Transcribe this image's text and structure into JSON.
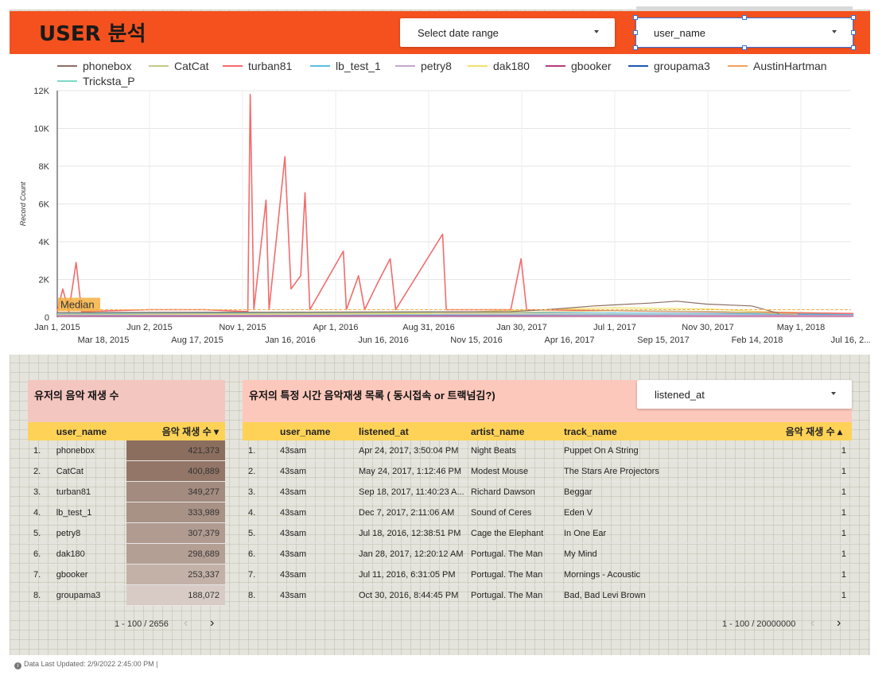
{
  "header": {
    "title": "USER 분석",
    "date_range_label": "Select date range",
    "user_filter_label": "user_name"
  },
  "legend": [
    "phonebox",
    "CatCat",
    "turban81",
    "lb_test_1",
    "petry8",
    "dak180",
    "gbooker",
    "groupama3",
    "AustinHartman",
    "Tricksta_P"
  ],
  "chart_data": {
    "type": "line",
    "ylabel": "Record Count",
    "ylim": [
      0,
      12000
    ],
    "y_ticks": [
      "0",
      "2K",
      "4K",
      "6K",
      "8K",
      "10K",
      "12K"
    ],
    "x_ticks_top": [
      "Jan 1, 2015",
      "Jun 2, 2015",
      "Nov 1, 2015",
      "Apr 1, 2016",
      "Aug 31, 2016",
      "Jan 30, 2017",
      "Jul 1, 2017",
      "Nov 30, 2017",
      "May 1, 2018"
    ],
    "x_ticks_bottom": [
      "Mar 18, 2015",
      "Aug 17, 2015",
      "Jan 16, 2016",
      "Jun 16, 2016",
      "Nov 15, 2016",
      "Apr 16, 2017",
      "Sep 15, 2017",
      "Feb 14, 2018",
      "Jul 16, 2..."
    ],
    "reference_line": {
      "label": "Median",
      "value": 400
    },
    "series": [
      {
        "name": "phonebox",
        "color": "#8d6e63",
        "points": [
          [
            "2015-01-01",
            250
          ],
          [
            "2016-06-01",
            280
          ],
          [
            "2017-01-15",
            300
          ],
          [
            "2017-03-15",
            400
          ],
          [
            "2017-06-01",
            600
          ],
          [
            "2017-09-01",
            750
          ],
          [
            "2017-10-15",
            850
          ],
          [
            "2017-12-01",
            700
          ],
          [
            "2018-02-15",
            600
          ],
          [
            "2018-04-01",
            200
          ]
        ]
      },
      {
        "name": "CatCat",
        "color": "#c5ca85",
        "points": [
          [
            "2015-01-01",
            150
          ],
          [
            "2016-01-01",
            200
          ],
          [
            "2017-01-01",
            250
          ],
          [
            "2017-08-01",
            350
          ],
          [
            "2018-01-01",
            300
          ],
          [
            "2018-05-01",
            150
          ]
        ]
      },
      {
        "name": "turban81",
        "color": "#f26b6b",
        "points": [
          [
            "2015-01-01",
            300
          ],
          [
            "2015-01-10",
            1500
          ],
          [
            "2015-01-20",
            300
          ],
          [
            "2015-02-01",
            2900
          ],
          [
            "2015-02-10",
            300
          ],
          [
            "2015-06-01",
            400
          ],
          [
            "2015-09-01",
            400
          ],
          [
            "2015-11-10",
            300
          ],
          [
            "2015-11-14",
            11800
          ],
          [
            "2015-11-20",
            400
          ],
          [
            "2015-12-10",
            6200
          ],
          [
            "2015-12-15",
            400
          ],
          [
            "2016-01-10",
            8500
          ],
          [
            "2016-01-20",
            1500
          ],
          [
            "2016-02-05",
            2200
          ],
          [
            "2016-02-12",
            6600
          ],
          [
            "2016-02-20",
            400
          ],
          [
            "2016-04-15",
            3500
          ],
          [
            "2016-04-20",
            400
          ],
          [
            "2016-05-10",
            2200
          ],
          [
            "2016-05-20",
            400
          ],
          [
            "2016-06-10",
            1800
          ],
          [
            "2016-07-01",
            3100
          ],
          [
            "2016-07-10",
            400
          ],
          [
            "2016-09-25",
            4400
          ],
          [
            "2016-10-01",
            400
          ],
          [
            "2017-01-15",
            400
          ],
          [
            "2017-02-01",
            3100
          ],
          [
            "2017-02-10",
            400
          ],
          [
            "2018-08-01",
            200
          ]
        ]
      },
      {
        "name": "lb_test_1",
        "color": "#5bc0de",
        "points": [
          [
            "2015-01-01",
            200
          ],
          [
            "2016-01-01",
            250
          ],
          [
            "2017-01-01",
            250
          ],
          [
            "2018-01-01",
            200
          ],
          [
            "2018-08-01",
            150
          ]
        ]
      },
      {
        "name": "petry8",
        "color": "#c3a8cf",
        "points": [
          [
            "2015-01-01",
            100
          ],
          [
            "2017-01-01",
            120
          ],
          [
            "2018-08-01",
            100
          ]
        ]
      },
      {
        "name": "dak180",
        "color": "#f1e06b",
        "points": [
          [
            "2015-01-01",
            100
          ],
          [
            "2016-09-01",
            200
          ],
          [
            "2017-01-01",
            350
          ],
          [
            "2017-07-01",
            500
          ],
          [
            "2017-12-01",
            450
          ],
          [
            "2018-03-01",
            300
          ],
          [
            "2018-08-01",
            200
          ]
        ]
      },
      {
        "name": "gbooker",
        "color": "#b73a7a",
        "points": [
          [
            "2015-01-01",
            50
          ],
          [
            "2018-08-01",
            50
          ]
        ]
      },
      {
        "name": "groupama3",
        "color": "#1e56b0",
        "points": [
          [
            "2015-01-01",
            80
          ],
          [
            "2017-01-01",
            100
          ],
          [
            "2018-08-01",
            120
          ]
        ]
      },
      {
        "name": "AustinHartman",
        "color": "#f5a05a",
        "points": [
          [
            "2015-01-01",
            180
          ],
          [
            "2017-01-01",
            220
          ],
          [
            "2018-08-01",
            200
          ]
        ]
      },
      {
        "name": "Tricksta_P",
        "color": "#7fd9c9",
        "points": [
          [
            "2015-01-01",
            120
          ],
          [
            "2017-01-01",
            150
          ],
          [
            "2018-08-01",
            120
          ]
        ]
      }
    ]
  },
  "left_table": {
    "title": "유저의 음악 재생 수",
    "headers": [
      "user_name",
      "음악 재생 수 ▾"
    ],
    "max_value": 421373,
    "rows": [
      {
        "num": "1.",
        "user": "phonebox",
        "count": "421,373",
        "value": 421373
      },
      {
        "num": "2.",
        "user": "CatCat",
        "count": "400,889",
        "value": 400889
      },
      {
        "num": "3.",
        "user": "turban81",
        "count": "349,277",
        "value": 349277
      },
      {
        "num": "4.",
        "user": "lb_test_1",
        "count": "333,989",
        "value": 333989
      },
      {
        "num": "5.",
        "user": "petry8",
        "count": "307,379",
        "value": 307379
      },
      {
        "num": "6.",
        "user": "dak180",
        "count": "298,689",
        "value": 298689
      },
      {
        "num": "7.",
        "user": "gbooker",
        "count": "253,337",
        "value": 253337
      },
      {
        "num": "8.",
        "user": "groupama3",
        "count": "188,072",
        "value": 188072
      }
    ],
    "pager": "1 - 100 / 2656"
  },
  "right_table": {
    "title": "유저의 특정 시간 음악재생 목록 ( 동시접속 or 트랙넘김?)",
    "filter_label": "listened_at",
    "headers": [
      "user_name",
      "listened_at",
      "artist_name",
      "track_name",
      "음악 재생 수 ▴"
    ],
    "rows": [
      {
        "num": "1.",
        "user": "43sam",
        "listened": "Apr 24, 2017, 3:50:04 PM",
        "artist": "Night Beats",
        "track": "Puppet On A String",
        "count": "1"
      },
      {
        "num": "2.",
        "user": "43sam",
        "listened": "May 24, 2017, 1:12:46 PM",
        "artist": "Modest Mouse",
        "track": "The Stars Are Projectors",
        "count": "1"
      },
      {
        "num": "3.",
        "user": "43sam",
        "listened": "Sep 18, 2017, 11:40:23 A...",
        "artist": "Richard Dawson",
        "track": "Beggar",
        "count": "1"
      },
      {
        "num": "4.",
        "user": "43sam",
        "listened": "Dec 7, 2017, 2:11:06 AM",
        "artist": "Sound of Ceres",
        "track": "Eden V",
        "count": "1"
      },
      {
        "num": "5.",
        "user": "43sam",
        "listened": "Jul 18, 2016, 12:38:51 PM",
        "artist": "Cage the Elephant",
        "track": "In One Ear",
        "count": "1"
      },
      {
        "num": "6.",
        "user": "43sam",
        "listened": "Jan 28, 2017, 12:20:12 AM",
        "artist": "Portugal. The Man",
        "track": "My Mind",
        "count": "1"
      },
      {
        "num": "7.",
        "user": "43sam",
        "listened": "Jul 11, 2016, 6:31:05 PM",
        "artist": "Portugal. The Man",
        "track": "Mornings - Acoustic",
        "count": "1"
      },
      {
        "num": "8.",
        "user": "43sam",
        "listened": "Oct 30, 2016, 8:44:45 PM",
        "artist": "Portugal. The Man",
        "track": "Bad, Bad Levi Brown",
        "count": "1"
      }
    ],
    "pager": "1 - 100 / 20000000"
  },
  "footer": {
    "text": "Data Last Updated: 2/9/2022 2:45:00 PM"
  },
  "colors": {
    "header_bg": "#f4511e",
    "table_header": "#fdd257",
    "left_panel_head": "#f4c6c0",
    "right_panel_head": "#fdc8bc",
    "heat_max": "#8c6e5f",
    "heat_min": "#d8cbc5"
  }
}
